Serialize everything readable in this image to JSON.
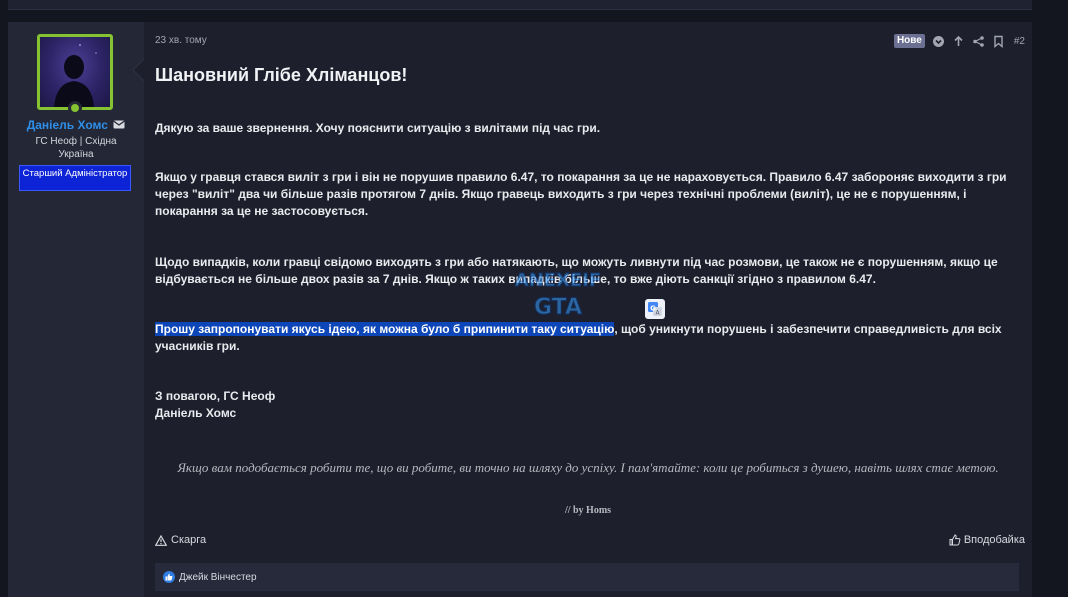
{
  "post": {
    "time": "23 хв. тому",
    "new_badge": "Нове",
    "number": "#2",
    "title": "Шановний Глібе Хліманцов!",
    "paragraphs": {
      "p1": "Дякую за ваше звернення. Хочу пояснити ситуацію з вилітами під час гри.",
      "p2": "Якщо у гравця стався виліт з гри і він не порушив правило 6.47, то покарання за це не нараховується. Правило 6.47 забороняє виходити з гри через \"виліт\" два чи більше разів протягом 7 днів. Якщо гравець виходить з гри через технічні проблеми (виліт), це не є порушенням, і покарання за це не застосовується.",
      "p3": "Щодо випадків, коли гравці свідомо виходять з гри або натякають, що можуть ливнути під час розмови, це також не є порушенням, якщо це відбувається не більше двох разів за 7 днів. Якщо ж таких випадків більше, то вже діють санкції згідно з правилом 6.47.",
      "p4_highlighted": "Прошу запропонувати якусь ідею, як можна було б припинити таку ситуацію",
      "p4_rest": ", щоб уникнути порушень і забезпечити справедливість для всіх учасників гри.",
      "signoff_line1": "З повагою, ГС Неоф",
      "signoff_line2": "Даніель Хомс"
    },
    "signature_quote": "Якщо вам подобається робити те, що ви робите, ви точно на шляху до успіху. І пам'ятайте: коли це робиться з душею, навіть шлях стає метою.",
    "signature_byline": "// by Homs",
    "watermark_line1": "ANEXEIF",
    "watermark_line2": "GTA",
    "report_label": "Скарга",
    "like_label": "Вподобайка",
    "reaction_user": "Джейк Вінчестер"
  },
  "author": {
    "name": "Даніель Хомс",
    "title": "ГС Неоф | Східна Україна",
    "role": "Старший Адміністратор"
  },
  "icons": {
    "mail": "mail-icon",
    "chevron": "chevron-down-circle-icon",
    "arrow_up": "arrow-up-icon",
    "share": "share-icon",
    "bookmark": "bookmark-icon",
    "report": "warning-triangle-icon",
    "like": "thumbs-up-icon",
    "reaction": "like-reaction-icon",
    "translate": "google-translate-icon"
  },
  "colors": {
    "username": "#2f8fe8",
    "avatar_border": "#86c332",
    "role_badge": "#0d23d6",
    "highlight": "#0c46b8",
    "new_badge": "#6b7093"
  }
}
